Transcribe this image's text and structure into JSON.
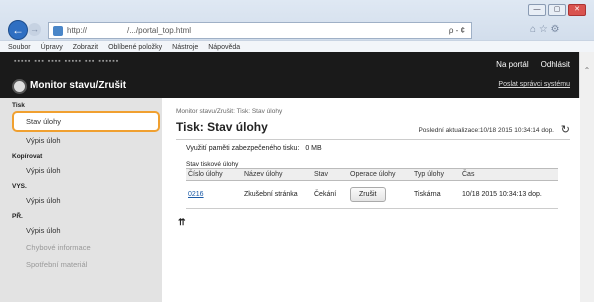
{
  "browser": {
    "url": "http://",
    "url_tail": "/.../portal_top.html",
    "tools": "ρ - ¢",
    "right_icons": "⌂ ☆ ⚙",
    "menu": [
      "Soubor",
      "Úpravy",
      "Zobrazit",
      "Oblíbené položky",
      "Nástroje",
      "Nápověda"
    ],
    "win_min": "—",
    "win_max": "▢",
    "win_close": "✕"
  },
  "header": {
    "system_line": "▪▪▪▪▪  ▪▪▪ ▪▪▪▪  ▪▪▪▪▪ ▪▪▪ ▪▪▪▪▪▪",
    "title": "Monitor stavu/Zrušit",
    "portal_link": "Na portál",
    "logout_link": "Odhlásit",
    "mail_link": "Poslat správci systému"
  },
  "sidebar": {
    "sections": [
      {
        "label": "Tisk",
        "items": [
          "Stav úlohy",
          "Výpis úloh"
        ]
      },
      {
        "label": "Kopírovat",
        "items": [
          "Výpis úloh"
        ]
      },
      {
        "label": "VYS.",
        "items": [
          "Výpis úloh"
        ]
      },
      {
        "label": "PŘ.",
        "items": [
          "Výpis úloh"
        ]
      }
    ],
    "extra": [
      "Chybové informace",
      "Spotřební materiál"
    ]
  },
  "main": {
    "breadcrumb": "Monitor stavu/Zrušit: Tisk: Stav úlohy",
    "title": "Tisk: Stav úlohy",
    "updated": "Poslední aktualizace:10/18 2015 10:34:14 dop.",
    "memory_label": "Využití paměti zabezpečeného tisku:",
    "memory_value": "0 MB",
    "table_title": "Stav tiskové úlohy",
    "columns": [
      "Číslo úlohy",
      "Název úlohy",
      "Stav",
      "Operace úlohy",
      "Typ úlohy",
      "Čas"
    ],
    "rows": [
      {
        "id": "0216",
        "name": "Zkušební stránka",
        "status": "Čekání",
        "action": "Zrušit",
        "type": "Tiskárna",
        "time": "10/18 2015 10:34:13 dop."
      }
    ],
    "to_top": "⇈"
  }
}
